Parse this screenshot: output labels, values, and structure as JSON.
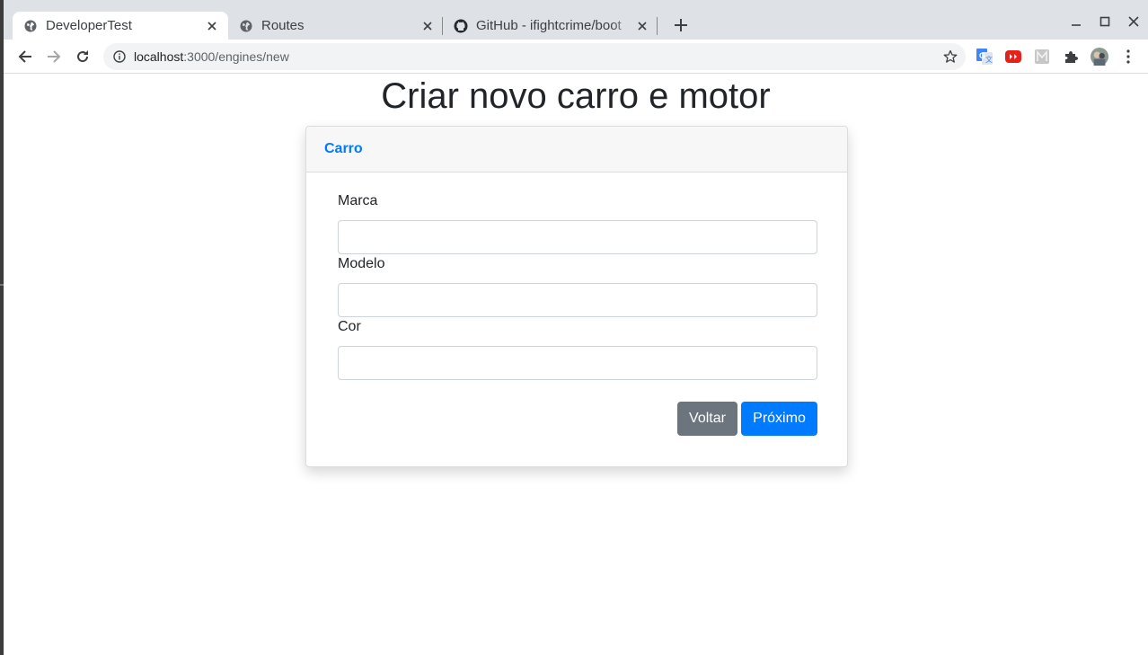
{
  "browser": {
    "tabs": [
      {
        "title": "DeveloperTest",
        "icon": "globe-icon",
        "active": true
      },
      {
        "title": "Routes",
        "icon": "globe-icon",
        "active": false
      },
      {
        "title": "GitHub - ifightcrime/boot",
        "icon": "github-icon",
        "active": false
      }
    ],
    "url_host": "localhost",
    "url_path": ":3000/engines/new",
    "extensions": [
      "google-translate-icon",
      "youtube-icon",
      "m-extension-icon",
      "puzzle-icon",
      "profile-avatar"
    ]
  },
  "page": {
    "title": "Criar novo carro e motor",
    "card_header": "Carro",
    "fields": [
      {
        "label": "Marca",
        "value": ""
      },
      {
        "label": "Modelo",
        "value": ""
      },
      {
        "label": "Cor",
        "value": ""
      }
    ],
    "buttons": {
      "back": "Voltar",
      "next": "Próximo"
    }
  },
  "colors": {
    "primary": "#007bff",
    "secondary": "#6c757d",
    "tabstrip": "#dee1e6"
  }
}
